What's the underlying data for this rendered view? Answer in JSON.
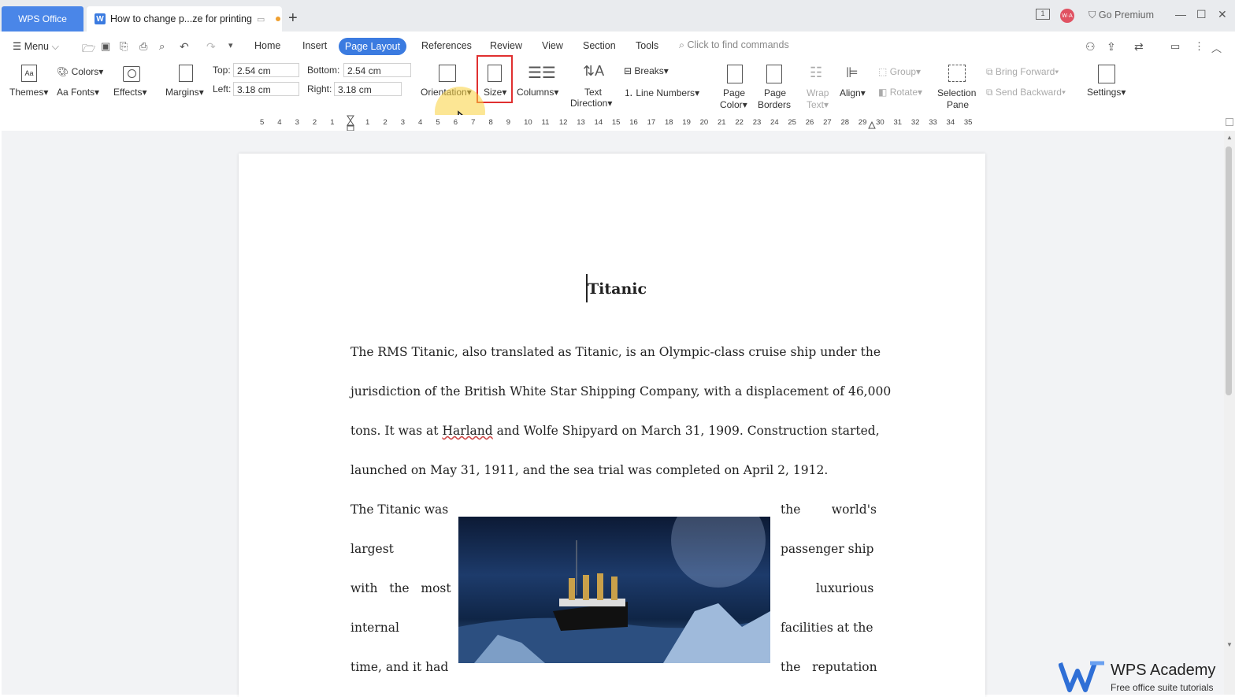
{
  "titlebar": {
    "app_tab": "WPS Office",
    "doc_tab": "How to change p...ze for printing",
    "go_premium": "Go Premium",
    "page_indicator": "1",
    "avatar_initials": "W·A"
  },
  "menu": {
    "menu_label": "Menu",
    "tabs": [
      "Home",
      "Insert",
      "Page Layout",
      "References",
      "Review",
      "View",
      "Section",
      "Tools"
    ],
    "active_tab": "Page Layout",
    "find_placeholder": "Click to find commands"
  },
  "ribbon": {
    "themes": "Themes",
    "colors": "Colors",
    "fonts": "Fonts",
    "effects": "Effects",
    "margins": "Margins",
    "top_label": "Top:",
    "top_value": "2.54 cm",
    "bottom_label": "Bottom:",
    "bottom_value": "2.54 cm",
    "left_label": "Left:",
    "left_value": "3.18 cm",
    "right_label": "Right:",
    "right_value": "3.18 cm",
    "orientation": "Orientation",
    "size": "Size",
    "columns": "Columns",
    "text_direction_1": "Text",
    "text_direction_2": "Direction",
    "breaks": "Breaks",
    "line_numbers": "Line Numbers",
    "page_color_1": "Page",
    "page_color_2": "Color",
    "page_borders_1": "Page",
    "page_borders_2": "Borders",
    "wrap_text_1": "Wrap",
    "wrap_text_2": "Text",
    "align": "Align",
    "group": "Group",
    "rotate": "Rotate",
    "selection_pane_1": "Selection",
    "selection_pane_2": "Pane",
    "bring_forward": "Bring Forward",
    "send_backward": "Send Backward",
    "settings": "Settings"
  },
  "ruler": {
    "left_ticks": [
      "5",
      "4",
      "3",
      "2",
      "1"
    ],
    "right_ticks": [
      "1",
      "2",
      "3",
      "4",
      "5",
      "6",
      "7",
      "8",
      "9",
      "10",
      "11",
      "12",
      "13",
      "14",
      "15",
      "16",
      "17",
      "18",
      "19",
      "20",
      "21",
      "22",
      "23",
      "24",
      "25",
      "26",
      "27",
      "28",
      "29",
      "30",
      "31",
      "32",
      "33",
      "34",
      "35"
    ]
  },
  "document": {
    "title": "Titanic",
    "p1_line1": "The RMS Titanic, also translated as Titanic, is an Olympic-class cruise ship under the",
    "p1_line2": "jurisdiction of the British White Star Shipping Company, with a displacement of 46,000",
    "p1_line3a": "tons. It was at",
    "p1_line3_harland": "Harland",
    "p1_line3b": "and Wolfe Shipyard on March 31, 1909. Construction started,",
    "p1_line4": "launched on May 31, 1911, and the sea trial was completed on April 2, 1912.",
    "left_col": [
      "The Titanic was",
      "largest",
      "with   the   most",
      "internal",
      "time, and it had"
    ],
    "right_col": [
      "the        world's",
      "passenger ship",
      "luxurious",
      "facilities at the",
      "the   reputation"
    ]
  },
  "academy": {
    "name": "WPS Academy",
    "tagline": "Free office suite tutorials"
  }
}
